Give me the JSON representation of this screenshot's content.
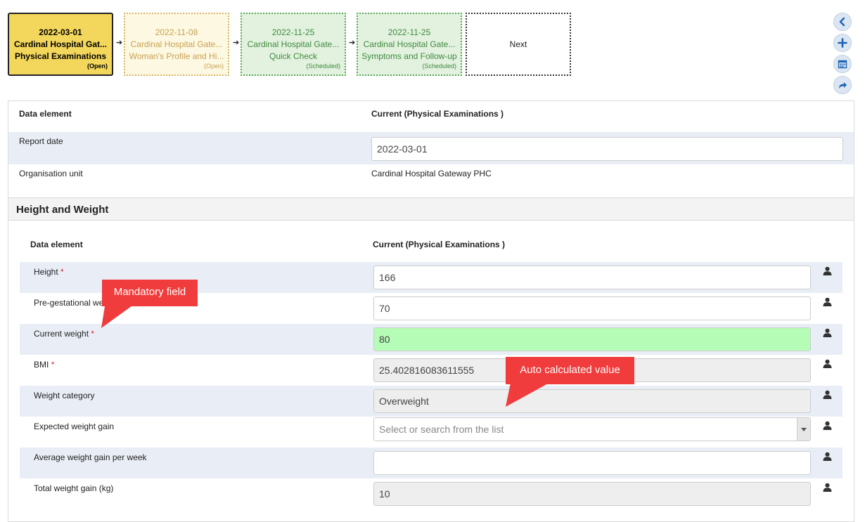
{
  "events": [
    {
      "date": "2022-03-01",
      "org": "Cardinal Hospital Gat...",
      "stage": "Physical Examinations",
      "status": "(Open)"
    },
    {
      "date": "2022-11-08",
      "org": "Cardinal Hospital Gate...",
      "stage": "Woman's Profile and Hi...",
      "status": "(Open)"
    },
    {
      "date": "2022-11-25",
      "org": "Cardinal Hospital Gate...",
      "stage": "Quick Check",
      "status": "(Scheduled)"
    },
    {
      "date": "2022-11-25",
      "org": "Cardinal Hospital Gate...",
      "stage": "Symptoms and Follow-up",
      "status": "(Scheduled)"
    }
  ],
  "next_label": "Next",
  "arrow": "➔",
  "side_icons": [
    "chevron-left-icon",
    "plus-icon",
    "calendar-icon",
    "share-icon"
  ],
  "top_table": {
    "col1": "Data element",
    "col2": "Current (Physical Examinations )",
    "report_date_label": "Report date",
    "report_date_value": "2022-03-01",
    "org_unit_label": "Organisation unit",
    "org_unit_value": "Cardinal Hospital Gateway PHC"
  },
  "section": {
    "title": "Height and Weight",
    "col1": "Data element",
    "col2": "Current (Physical Examinations )",
    "rows": [
      {
        "label": "Height",
        "required": "*",
        "value": "166",
        "placeholder": ""
      },
      {
        "label": "Pre-gestational weight",
        "required": "",
        "value": "70",
        "placeholder": ""
      },
      {
        "label": "Current weight",
        "required": "*",
        "value": "80",
        "placeholder": ""
      },
      {
        "label": "BMI",
        "required": "*",
        "value": "25.402816083611555",
        "placeholder": ""
      },
      {
        "label": "Weight category",
        "required": "",
        "value": "Overweight",
        "placeholder": ""
      },
      {
        "label": "Expected weight gain",
        "required": "",
        "value": "",
        "placeholder": "Select or search from the list"
      },
      {
        "label": "Average weight gain per week",
        "required": "",
        "value": "",
        "placeholder": ""
      },
      {
        "label": "Total weight gain (kg)",
        "required": "",
        "value": "10",
        "placeholder": ""
      }
    ]
  },
  "callouts": {
    "mandatory": "Mandatory field",
    "auto": "Auto calculated value"
  },
  "colors": {
    "active_event": "#f3d75c",
    "open_event": "#fdf8e1",
    "scheduled_event": "#e3f2df",
    "valid_field": "#b5fdb6",
    "readonly_field": "#eeeeee",
    "callout": "#f03c3c",
    "row_stripe": "#e9eef6"
  }
}
